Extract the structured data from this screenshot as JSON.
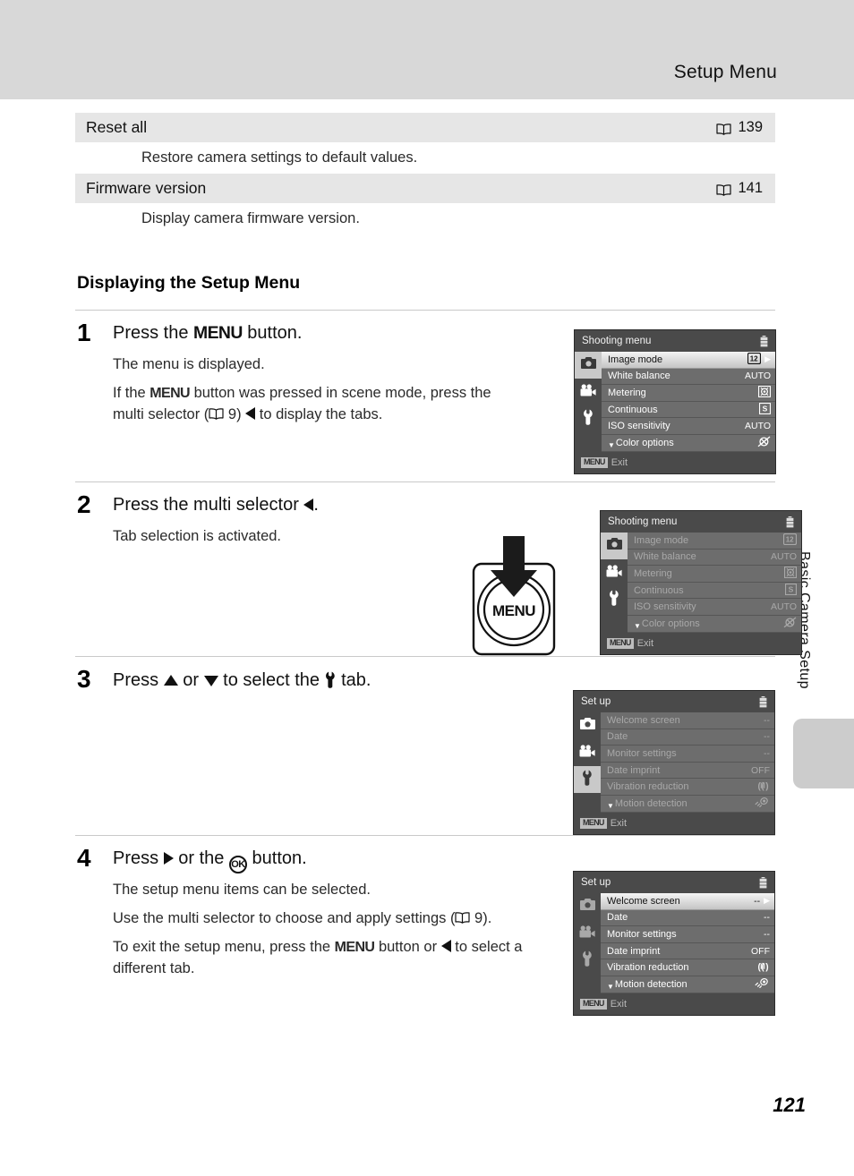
{
  "header": {
    "title": "Setup Menu"
  },
  "side_tab": {
    "label": "Basic Camera Setup"
  },
  "page_number": "121",
  "spec_table": {
    "rows": [
      {
        "name": "Reset all",
        "ref": "139",
        "desc": "Restore camera settings to default values."
      },
      {
        "name": "Firmware version",
        "ref": "141",
        "desc": "Display camera firmware version."
      }
    ]
  },
  "section": {
    "heading": "Displaying the Setup Menu"
  },
  "steps": [
    {
      "num": "1",
      "title_a": "Press the ",
      "title_menu": "MENU",
      "title_b": " button.",
      "p1": "The menu is displayed.",
      "p2_a": "If the ",
      "p2_menu": "MENU",
      "p2_b": " button was pressed in scene mode, press the multi selector (",
      "p2_ref": "9",
      "p2_c": ") ",
      "p2_d": " to display the tabs."
    },
    {
      "num": "2",
      "title_a": "Press the multi selector ",
      "title_b": ".",
      "p1": "Tab selection is activated."
    },
    {
      "num": "3",
      "title_a": "Press ",
      "title_or": " or ",
      "title_b": " to select the ",
      "title_c": " tab."
    },
    {
      "num": "4",
      "title_a": "Press ",
      "title_b": " or the ",
      "title_ok": "OK",
      "title_c": " button.",
      "p1": "The setup menu items can be selected.",
      "p2_a": "Use the multi selector to choose and apply settings (",
      "p2_ref": "9",
      "p2_b": ").",
      "p3_a": "To exit the setup menu, press the ",
      "p3_menu": "MENU",
      "p3_b": " button or ",
      "p3_c": " to select a different tab."
    }
  ],
  "menu_button_illustration": {
    "label": "MENU"
  },
  "lcd_screens": [
    {
      "id": "screen-1",
      "title": "Shooting menu",
      "active_tab": "camera",
      "tabs_dimmed": false,
      "rows_dimmed": false,
      "highlight_index": 0,
      "rows": [
        {
          "label": "Image mode",
          "value_icon": "image-mode-12m-icon",
          "value": ""
        },
        {
          "label": "White balance",
          "value_icon": "",
          "value": "AUTO"
        },
        {
          "label": "Metering",
          "value_icon": "metering-matrix-icon",
          "value": ""
        },
        {
          "label": "Continuous",
          "value_icon": "continuous-single-icon",
          "value": ""
        },
        {
          "label": "ISO sensitivity",
          "value_icon": "",
          "value": "AUTO"
        },
        {
          "label": "Color options",
          "value_icon": "color-options-standard-icon",
          "value": ""
        }
      ],
      "footer_chip": "MENU",
      "footer_label": "Exit"
    },
    {
      "id": "screen-2",
      "title": "Shooting menu",
      "active_tab": "camera",
      "tabs_dimmed": false,
      "rows_dimmed": true,
      "highlight_index": -1,
      "rows": [
        {
          "label": "Image mode",
          "value_icon": "image-mode-12m-icon",
          "value": ""
        },
        {
          "label": "White balance",
          "value_icon": "",
          "value": "AUTO"
        },
        {
          "label": "Metering",
          "value_icon": "metering-matrix-icon",
          "value": ""
        },
        {
          "label": "Continuous",
          "value_icon": "continuous-single-icon",
          "value": ""
        },
        {
          "label": "ISO sensitivity",
          "value_icon": "",
          "value": "AUTO"
        },
        {
          "label": "Color options",
          "value_icon": "color-options-standard-icon",
          "value": ""
        }
      ],
      "footer_chip": "MENU",
      "footer_label": "Exit"
    },
    {
      "id": "screen-3",
      "title": "Set up",
      "active_tab": "wrench",
      "tabs_dimmed": false,
      "rows_dimmed": true,
      "highlight_index": -1,
      "rows": [
        {
          "label": "Welcome screen",
          "value_icon": "",
          "value": "--"
        },
        {
          "label": "Date",
          "value_icon": "",
          "value": "--"
        },
        {
          "label": "Monitor settings",
          "value_icon": "",
          "value": "--"
        },
        {
          "label": "Date imprint",
          "value_icon": "",
          "value": "OFF"
        },
        {
          "label": "Vibration reduction",
          "value_icon": "vibration-reduction-icon",
          "value": ""
        },
        {
          "label": "Motion detection",
          "value_icon": "motion-detection-icon",
          "value": ""
        }
      ],
      "footer_chip": "MENU",
      "footer_label": "Exit"
    },
    {
      "id": "screen-4",
      "title": "Set up",
      "active_tab": "wrench",
      "tabs_dimmed": true,
      "rows_dimmed": false,
      "highlight_index": 0,
      "rows": [
        {
          "label": "Welcome screen",
          "value_icon": "",
          "value": "--"
        },
        {
          "label": "Date",
          "value_icon": "",
          "value": "--"
        },
        {
          "label": "Monitor settings",
          "value_icon": "",
          "value": "--"
        },
        {
          "label": "Date imprint",
          "value_icon": "",
          "value": "OFF"
        },
        {
          "label": "Vibration reduction",
          "value_icon": "vibration-reduction-icon",
          "value": ""
        },
        {
          "label": "Motion detection",
          "value_icon": "motion-detection-icon",
          "value": ""
        }
      ],
      "footer_chip": "MENU",
      "footer_label": "Exit"
    }
  ],
  "colors": {
    "header_band": "#d8d8d8",
    "spec_row": "#e6e6e6",
    "lcd_frame": "#3f3f3f",
    "lcd_bar": "#4a4a4a",
    "lcd_row": "#6d6d6d",
    "side_thumb": "#cccccc"
  }
}
